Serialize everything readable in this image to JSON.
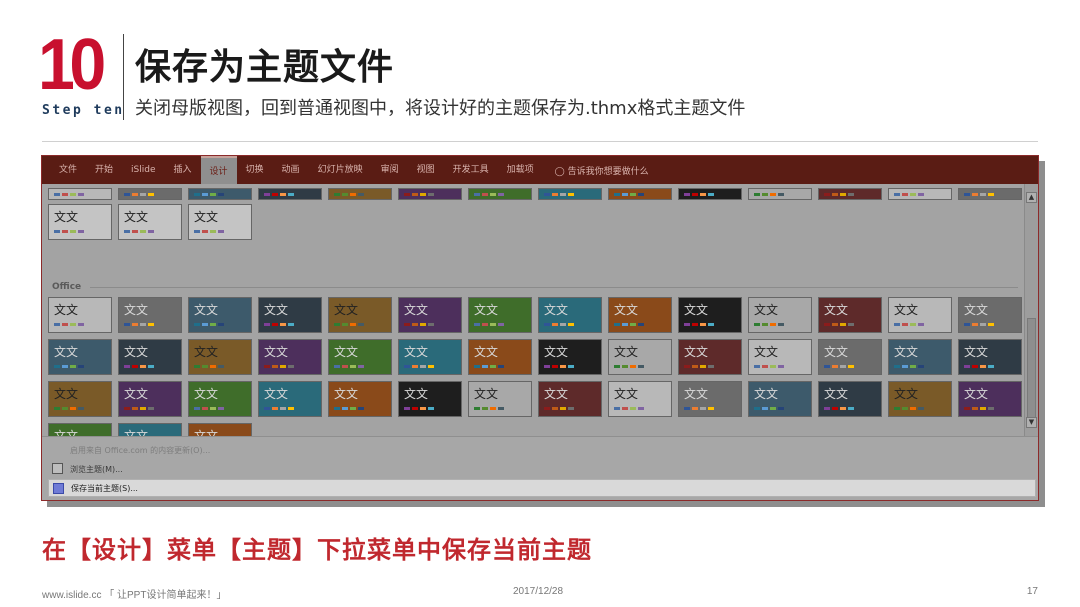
{
  "header": {
    "step_number": "10",
    "step_label": "Step ten",
    "title": "保存为主题文件",
    "subtitle": "关闭母版视图，回到普通视图中，将设计好的主题保存为.thmx格式主题文件"
  },
  "ribbon": {
    "tabs": [
      {
        "label": "文件",
        "active": false
      },
      {
        "label": "开始",
        "active": false
      },
      {
        "label": "iSlide",
        "active": false
      },
      {
        "label": "插入",
        "active": false
      },
      {
        "label": "设计",
        "active": true
      },
      {
        "label": "切换",
        "active": false
      },
      {
        "label": "动画",
        "active": false
      },
      {
        "label": "幻灯片放映",
        "active": false
      },
      {
        "label": "审阅",
        "active": false
      },
      {
        "label": "视图",
        "active": false
      },
      {
        "label": "开发工具",
        "active": false
      },
      {
        "label": "加载项",
        "active": false
      }
    ],
    "search_icon": "lightbulb-icon",
    "search_text": "告诉我你想要做什么"
  },
  "gallery": {
    "thumb_text": "文文",
    "office_section_label": "Office",
    "custom_themes_count": 3,
    "office_themes_count": 45
  },
  "menu": {
    "enable_updates": "启用来自 Office.com 的内容更新(O)...",
    "browse_themes": "浏览主题(M)...",
    "save_current_theme": "保存当前主题(S)..."
  },
  "caption": "在【设计】菜单【主题】下拉菜单中保存当前主题",
  "footer": {
    "left": "www.islide.cc 「 让PPT设计简单起来！」",
    "date": "2017/12/28",
    "page": "17"
  },
  "colors": {
    "accent_red": "#c8102e",
    "ribbon_bg": "#5a1c14",
    "caption_red": "#c0282e"
  }
}
